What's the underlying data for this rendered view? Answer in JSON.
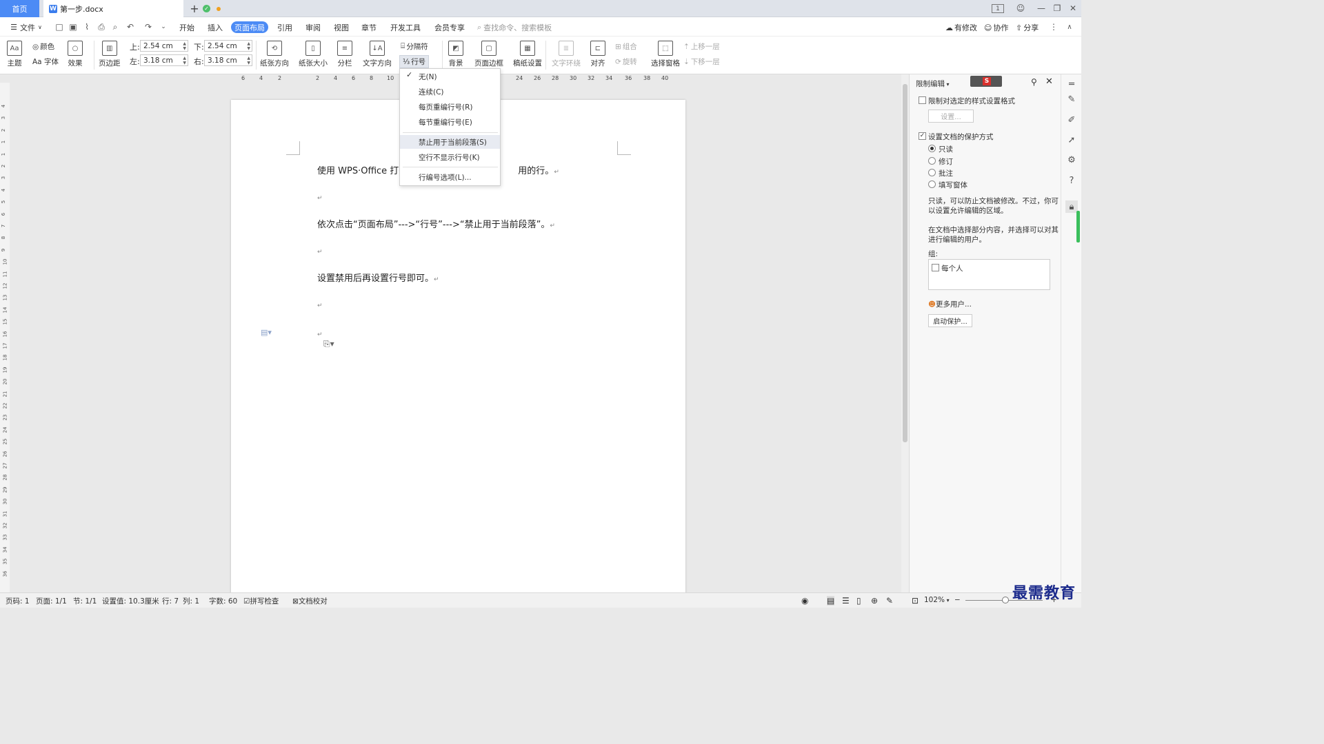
{
  "tabs": {
    "home": "首页",
    "doc": "第一步.docx",
    "new": "+"
  },
  "menu": {
    "file": "文件",
    "items": [
      "开始",
      "插入",
      "页面布局",
      "引用",
      "审阅",
      "视图",
      "章节",
      "开发工具",
      "会员专享"
    ],
    "active": "页面布局",
    "search": "查找命令、搜索模板",
    "modified": "有修改",
    "collab": "协作",
    "share": "分享"
  },
  "ribbon": {
    "theme": "主题",
    "color": "颜色",
    "font": "Aa 字体",
    "effect": "效果",
    "margins": "页边距",
    "top_label": "上:",
    "top": "2.54 cm",
    "bottom_label": "下:",
    "bottom": "2.54 cm",
    "left_label": "左:",
    "left": "3.18 cm",
    "right_label": "右:",
    "right": "3.18 cm",
    "orientation": "纸张方向",
    "size": "纸张大小",
    "columns": "分栏",
    "text_dir": "文字方向",
    "separator": "分隔符",
    "line_num": "行号",
    "background": "背景",
    "page_border": "页面边框",
    "draft": "稿纸设置",
    "wrap": "文字环绕",
    "align": "对齐",
    "group": "组合",
    "rotate": "旋转",
    "select_pane": "选择窗格",
    "bring_fwd": "上移一层",
    "send_back": "下移一层"
  },
  "ruler": [
    "6",
    "4",
    "2",
    "2",
    "4",
    "6",
    "8",
    "10",
    "24",
    "26",
    "28",
    "30",
    "32",
    "34",
    "36",
    "38",
    "40"
  ],
  "vruler": [
    "4",
    "3",
    "2",
    "1",
    "1",
    "2",
    "3",
    "4",
    "5",
    "6",
    "7",
    "8",
    "9",
    "10",
    "11",
    "12",
    "13",
    "14",
    "15",
    "16",
    "17",
    "18",
    "19",
    "20",
    "21",
    "22",
    "23",
    "24",
    "25",
    "26",
    "27",
    "28",
    "29",
    "30",
    "31",
    "32",
    "33",
    "34",
    "35",
    "36"
  ],
  "document": {
    "p1a": "使用 WPS·Office 打开",
    "p1b": "用的行。",
    "p2": "依次点击“页面布局”--->“行号”--->“禁止用于当前段落”。",
    "p3": "设置禁用后再设置行号即可。",
    "mark": "↵"
  },
  "dropdown": {
    "none": "无(N)",
    "continuous": "连续(C)",
    "restart_page": "每页重编行号(R)",
    "restart_section": "每节重编行号(E)",
    "suppress": "禁止用于当前段落(S)",
    "blank": "空行不显示行号(K)",
    "options": "行编号选项(L)..."
  },
  "panel": {
    "title": "限制编辑",
    "restrict_format": "限制对选定的样式设置格式",
    "settings_btn": "设置...",
    "protect": "设置文档的保护方式",
    "readonly": "只读",
    "track": "修订",
    "comment": "批注",
    "form": "填写窗体",
    "desc1a": "只读，可以防止文档被修改。不过，你可",
    "desc1b": "以设置允许编辑的区域。",
    "desc2a": "在文档中选择部分内容，并选择可以对其",
    "desc2b": "进行编辑的用户。",
    "group": "组:",
    "everyone": "每个人",
    "more_users": "更多用户...",
    "start_protect": "启动保护..."
  },
  "status": {
    "page": "页码: 1",
    "pages": "页面: 1/1",
    "section": "节: 1/1",
    "setting": "设置值: 10.3厘米",
    "line": "行: 7",
    "col": "列: 1",
    "words": "字数: 60",
    "spell": "拼写检查",
    "proof": "文档校对",
    "zoom": "102%"
  },
  "watermark": "最需教育"
}
